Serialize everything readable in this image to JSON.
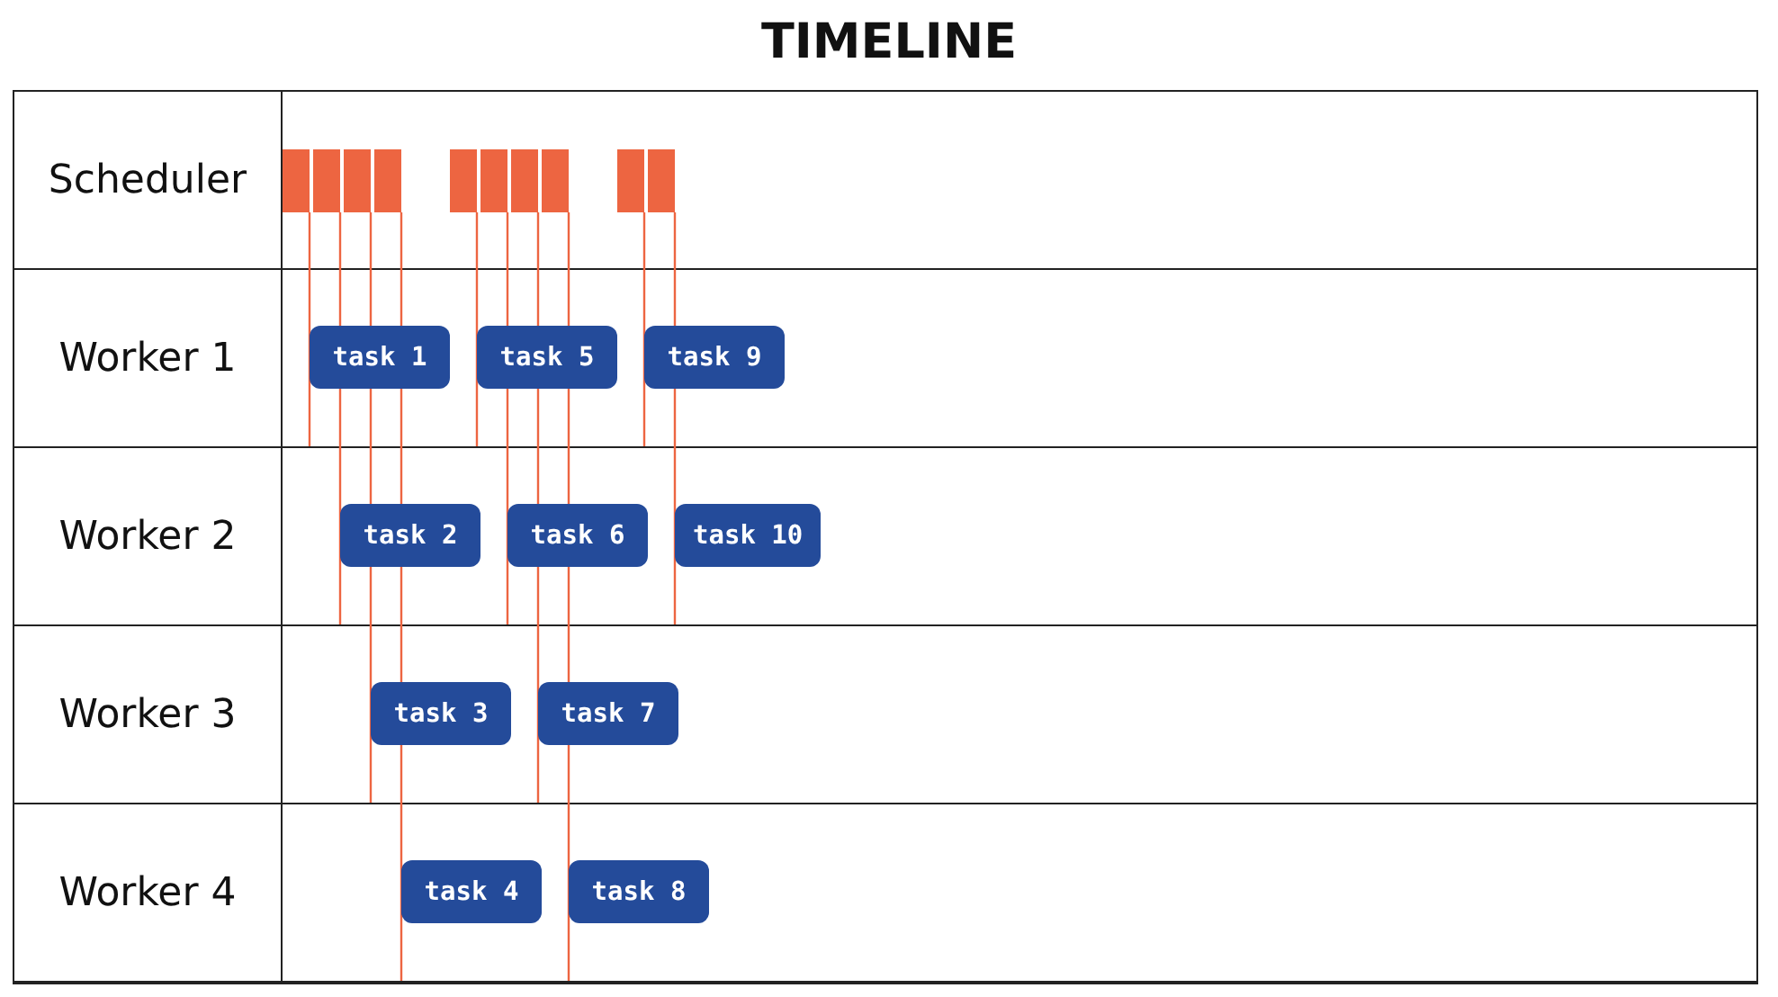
{
  "title": "TIMELINE",
  "scheduler": {
    "label": "Scheduler"
  },
  "workers": [
    {
      "label": "Worker 1"
    },
    {
      "label": "Worker 2"
    },
    {
      "label": "Worker 3"
    },
    {
      "label": "Worker 4"
    }
  ],
  "rounds": [
    {
      "tasks": [
        "task 1",
        "task 2",
        "task 3",
        "task 4"
      ]
    },
    {
      "tasks": [
        "task 5",
        "task 6",
        "task 7",
        "task 8"
      ]
    },
    {
      "tasks": [
        "task 9",
        "task 10"
      ]
    }
  ]
}
